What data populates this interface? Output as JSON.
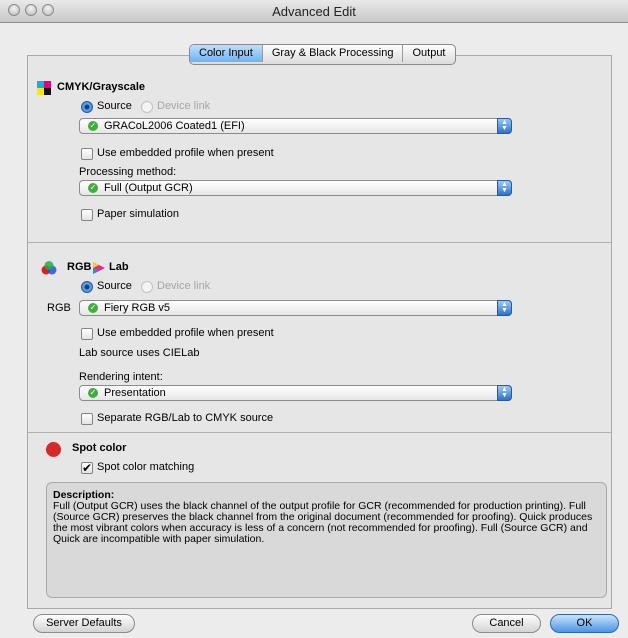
{
  "window": {
    "title": "Advanced Edit"
  },
  "tabs": [
    {
      "label": "Color Input",
      "active": true
    },
    {
      "label": "Gray & Black Processing",
      "active": false
    },
    {
      "label": "Output",
      "active": false
    }
  ],
  "cmyk": {
    "header": "CMYK/Grayscale",
    "source_label": "Source",
    "device_link_label": "Device link",
    "profile": "GRACoL2006 Coated1 (EFI)",
    "use_embedded_label": "Use embedded profile when present",
    "processing_label": "Processing method:",
    "processing_value": "Full (Output GCR)",
    "paper_sim_label": "Paper simulation"
  },
  "rgb": {
    "header_rgb": "RGB",
    "header_lab": "Lab",
    "source_label": "Source",
    "device_link_label": "Device link",
    "rgb_label": "RGB",
    "profile": "Fiery RGB v5",
    "use_embedded_label": "Use embedded profile when present",
    "lab_note": "Lab source uses CIELab",
    "rendering_label": "Rendering intent:",
    "rendering_value": "Presentation",
    "separate_label": "Separate RGB/Lab to CMYK source"
  },
  "spot": {
    "header": "Spot color",
    "matching_label": "Spot color matching",
    "matching_checked": true
  },
  "description": {
    "title": "Description:",
    "text": "Full (Output GCR) uses the black channel of the output profile for GCR (recommended for production printing). Full (Source GCR) preserves the black channel from the original document (recommended for proofing). Quick produces the most vibrant colors when accuracy is less of a concern (not recommended for proofing). Full (Source GCR) and Quick are incompatible with paper simulation."
  },
  "buttons": {
    "server_defaults": "Server Defaults",
    "cancel": "Cancel",
    "ok": "OK"
  },
  "colors": {
    "accent": "#4a96e6",
    "spot_dot": "#d42a2a"
  }
}
